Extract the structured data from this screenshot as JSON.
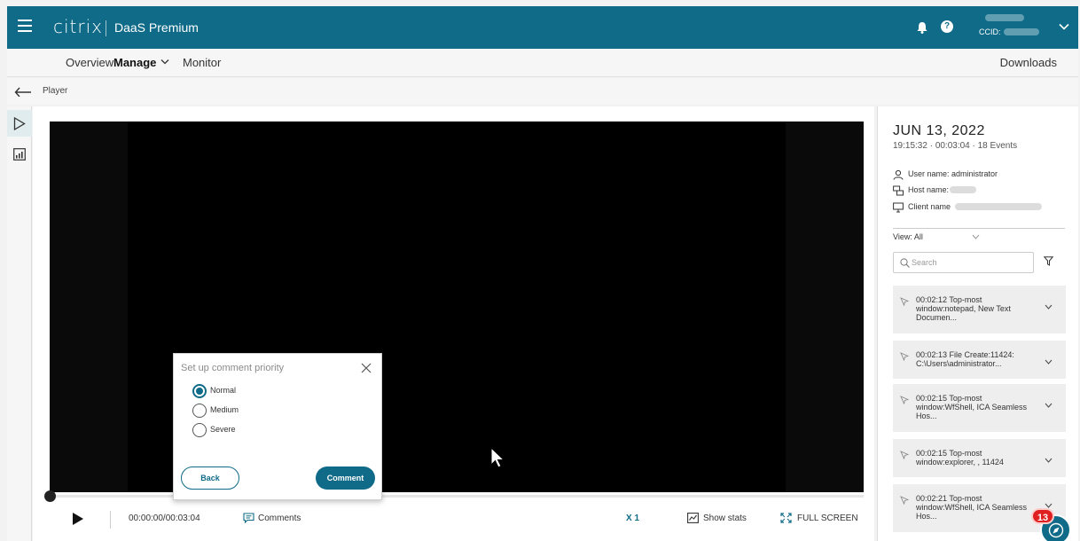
{
  "header": {
    "logo": "citrix",
    "product": "DaaS Premium",
    "ccid_label": "CCID:",
    "bell_icon": "bell-icon",
    "help_icon": "help-icon",
    "help_glyph": "?"
  },
  "nav": {
    "overview": "Overview",
    "manage": "Manage",
    "monitor": "Monitor",
    "downloads": "Downloads"
  },
  "breadcrumb": {
    "label": "Player"
  },
  "player": {
    "time": "00:00:00/00:03:04",
    "comments": "Comments",
    "speed": "X 1",
    "show_stats": "Show stats",
    "full_screen": "FULL SCREEN",
    "progress": 0
  },
  "dialog": {
    "title": "Set up comment priority",
    "options": [
      "Normal",
      "Medium",
      "Severe"
    ],
    "selected": "Normal",
    "back": "Back",
    "comment": "Comment"
  },
  "panel": {
    "date": "JUN 13, 2022",
    "meta": "19:15:32 · 00:03:04 · 18 Events",
    "user_name": "User name: administrator",
    "host_name": "Host name:",
    "client_name": "Client name",
    "view": "View:  All",
    "search_placeholder": "Search",
    "events": [
      {
        "text": "00:02:12 Top-most window:notepad, New Text Documen..."
      },
      {
        "text": "00:02:13 File Create:11424: C:\\Users\\administrator..."
      },
      {
        "text": "00:02:15 Top-most window:WfShell, ICA Seamless Hos..."
      },
      {
        "text": "00:02:15 Top-most window:explorer, , 11424"
      },
      {
        "text": "00:02:21 Top-most window:WfShell, ICA Seamless Hos..."
      }
    ]
  },
  "badge": {
    "count": "13"
  },
  "colors": {
    "brand": "#0f6b88",
    "badge": "#e02020"
  }
}
